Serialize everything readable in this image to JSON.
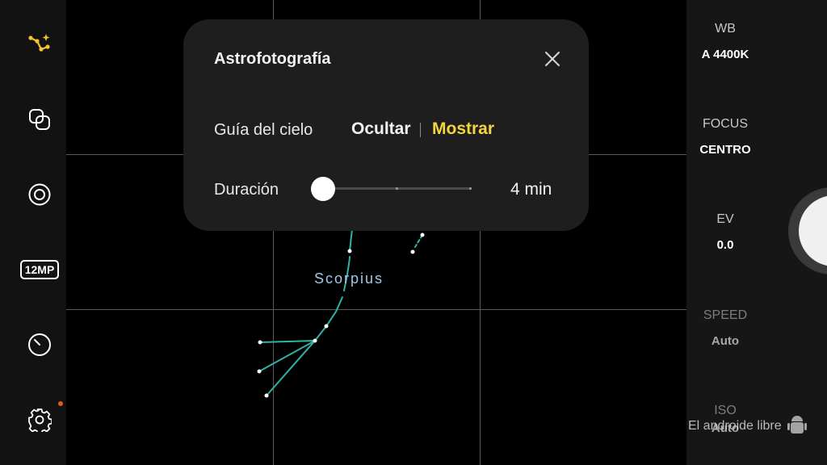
{
  "left_toolbar": {
    "icons": [
      "astro-mode-icon",
      "filter-icon",
      "lens-switch-icon",
      "resolution-icon",
      "timer-icon",
      "settings-icon"
    ],
    "resolution_label": "12MP",
    "accent_color": "#f5c531"
  },
  "dialog": {
    "title": "Astrofotografía",
    "sky_guide": {
      "label": "Guía del cielo",
      "options": [
        "Ocultar",
        "Mostrar"
      ],
      "selected": "Mostrar"
    },
    "duration": {
      "label": "Duración",
      "value": "4 min",
      "fraction": 0.0
    },
    "selected_color": "#f5d53c"
  },
  "viewfinder": {
    "constellation_name": "Scorpius",
    "line_color": "#2fb3a8"
  },
  "right_panel": {
    "wb": {
      "label": "WB",
      "value": "A 4400K"
    },
    "focus": {
      "label": "FOCUS",
      "value": "CENTRO"
    },
    "ev": {
      "label": "EV",
      "value": "0.0"
    },
    "speed": {
      "label": "SPEED",
      "value": "Auto"
    },
    "iso": {
      "label": "ISO",
      "value": "Auto"
    }
  },
  "watermark": "El androide libre"
}
